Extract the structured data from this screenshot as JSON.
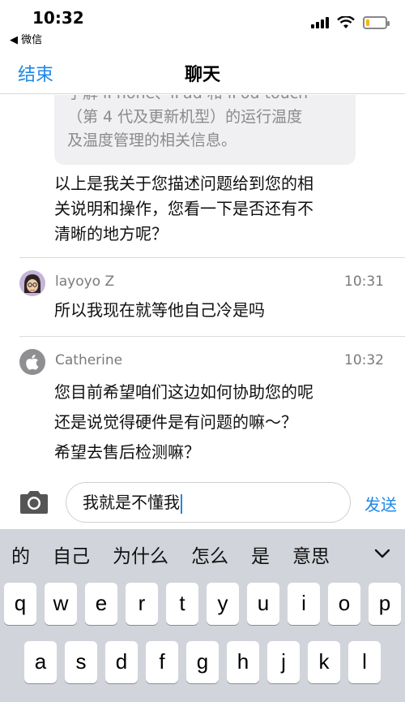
{
  "status_bar": {
    "time": "10:32",
    "back_app": "◀ 微信",
    "battery_level": 0.2,
    "battery_color": "#f5b800",
    "icons": [
      "signal-icon",
      "wifi-icon",
      "battery-icon"
    ]
  },
  "nav": {
    "end_label": "结束",
    "title": "聊天",
    "accent": "#1e88e5"
  },
  "chat": {
    "quoted_lines": [
      "了解 iPhone、iPad 和 iPod touch",
      "（第 4 代及更新机型）的运行温度",
      "及温度管理的相关信息。"
    ],
    "agent_lines": [
      "以上是我关于您描述问题给到您的相",
      "关说明和操作，您看一下是否还有不",
      "清晰的地方呢？"
    ],
    "messages": [
      {
        "sender": "layoyo Z",
        "time": "10:31",
        "avatar": "memoji-avatar",
        "lines": [
          "所以我现在就等他自己冷是吗"
        ]
      },
      {
        "sender": "Catherine",
        "time": "10:32",
        "avatar": "apple-logo-avatar",
        "lines": [
          "您目前希望咱们这边如何协助您的呢",
          "还是说觉得硬件是有问题的嘛～？",
          "希望去售后检测嘛？"
        ]
      }
    ]
  },
  "input": {
    "value": "我就是不懂我",
    "send_label": "发送",
    "camera_icon": "camera-icon"
  },
  "keyboard": {
    "candidates": [
      "的",
      "自己",
      "为什么",
      "怎么",
      "是",
      "意思"
    ],
    "row1": [
      "q",
      "w",
      "e",
      "r",
      "t",
      "y",
      "u",
      "i",
      "o",
      "p"
    ],
    "row2": [
      "a",
      "s",
      "d",
      "f",
      "g",
      "h",
      "j",
      "k",
      "l"
    ]
  }
}
